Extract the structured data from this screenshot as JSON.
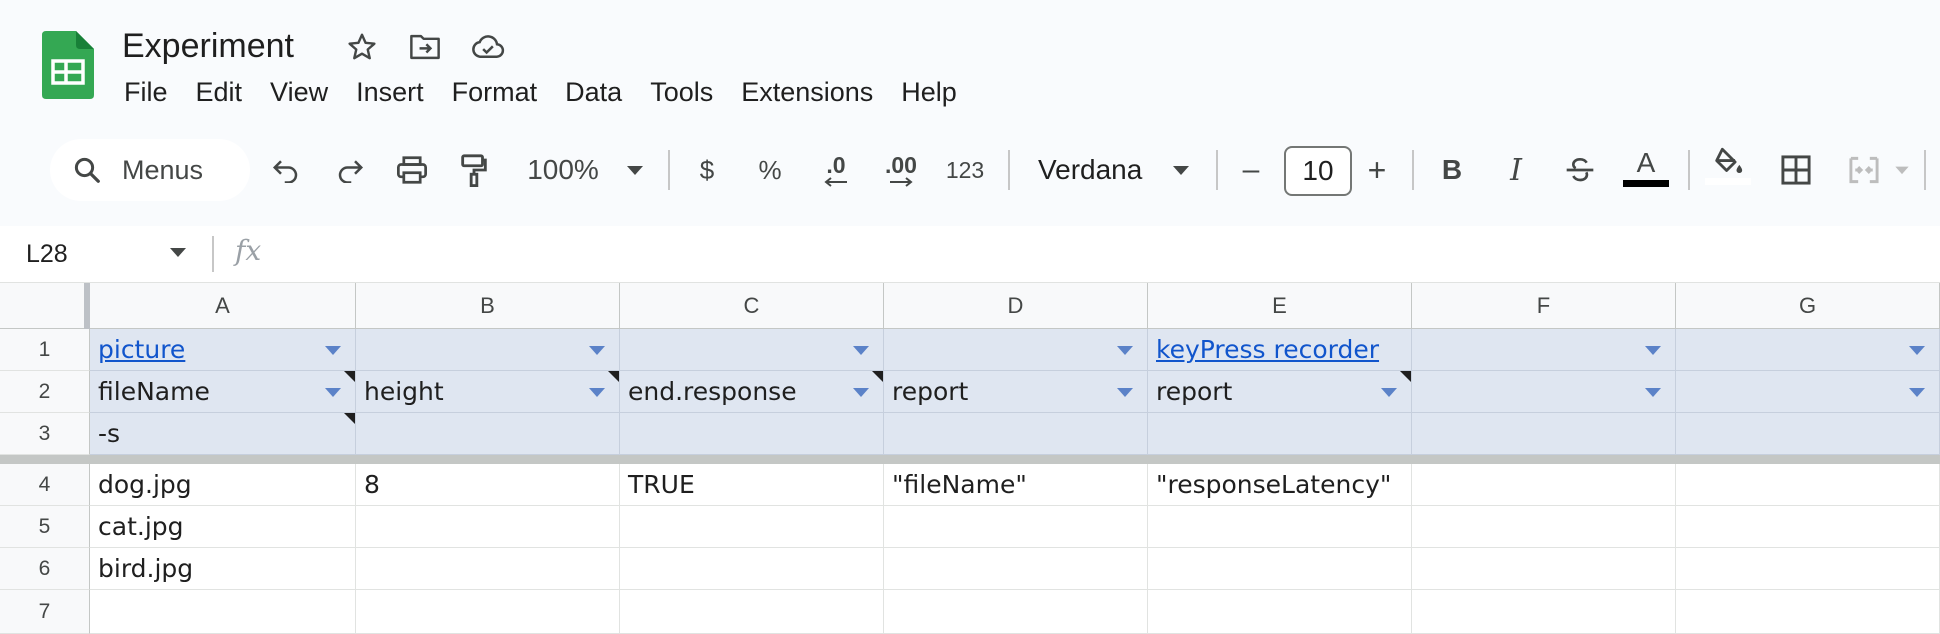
{
  "app": {
    "title": "Experiment",
    "brand_color": "#0f9d58"
  },
  "menu": [
    "File",
    "Edit",
    "View",
    "Insert",
    "Format",
    "Data",
    "Tools",
    "Extensions",
    "Help"
  ],
  "toolbar": {
    "search_label": "Menus",
    "zoom": "100%",
    "currency": "$",
    "percent": "%",
    "decrease_decimal": ".0",
    "increase_decimal": ".00",
    "number_format": "123",
    "font": "Verdana",
    "font_size": "10",
    "minus": "–",
    "plus": "+",
    "bold": "B",
    "italic": "I",
    "text_color_label": "A",
    "text_color": "#000000",
    "icons": [
      "search-icon",
      "undo-icon",
      "redo-icon",
      "print-icon",
      "paint-format-icon",
      "chevron-down-icon",
      "strikethrough-icon",
      "fill-color-icon",
      "borders-icon",
      "merge-cells-icon"
    ]
  },
  "formula_bar": {
    "cell_ref": "L28",
    "fx": "fx",
    "value": ""
  },
  "columns": [
    "A",
    "B",
    "C",
    "D",
    "E",
    "F",
    "G"
  ],
  "rows": [
    "1",
    "2",
    "3",
    "4",
    "5",
    "6",
    "7"
  ],
  "cells": {
    "r1": [
      "picture",
      "",
      "",
      "",
      "keyPress recorder",
      "",
      ""
    ],
    "r2": [
      "fileName",
      "height",
      "end.response",
      "report",
      "report",
      "",
      ""
    ],
    "r3": [
      "-s",
      "",
      "",
      "",
      "",
      "",
      ""
    ],
    "r4": [
      "dog.jpg",
      "8",
      "TRUE",
      "\"fileName\"",
      "\"responseLatency\"",
      "",
      ""
    ],
    "r5": [
      "cat.jpg",
      "",
      "",
      "",
      "",
      "",
      ""
    ],
    "r6": [
      "bird.jpg",
      "",
      "",
      "",
      "",
      "",
      ""
    ],
    "r7": [
      "",
      "",
      "",
      "",
      "",
      "",
      ""
    ]
  },
  "colors": {
    "header_band": "#dfe6f1",
    "link": "#1155cc",
    "dropdown_arrow": "#5b82c8"
  }
}
